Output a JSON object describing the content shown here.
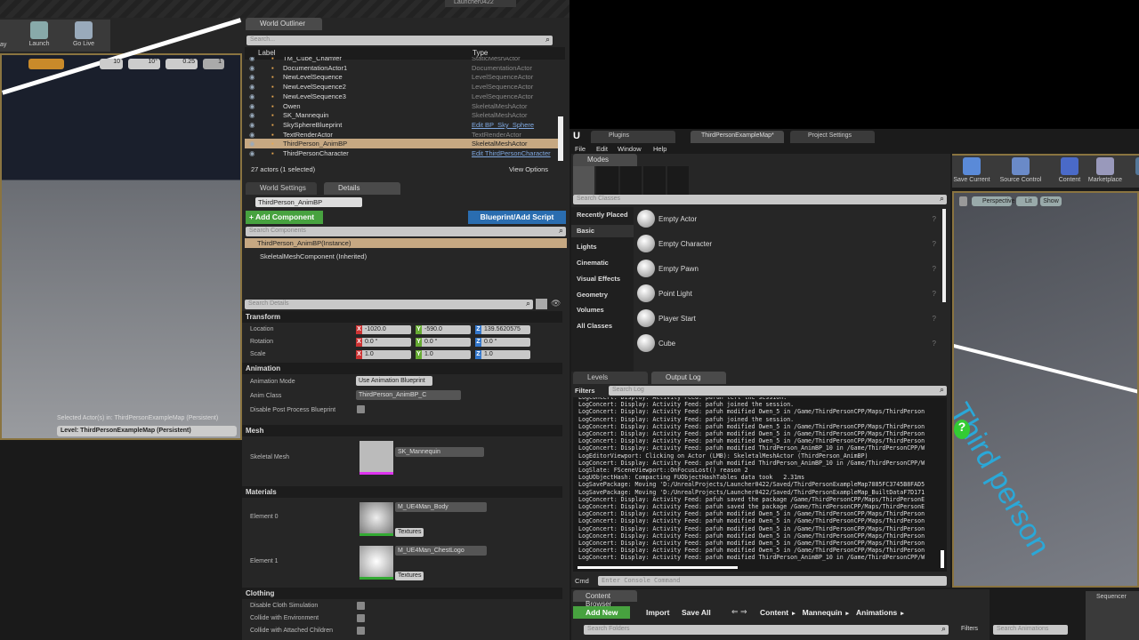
{
  "window_title": "Launcher0422",
  "left_toolbar": {
    "launch": "Launch",
    "go_live": "Go Live",
    "play_fragment": "ay",
    "grid_snap": "10",
    "rot_snap": "10°",
    "scale_snap": "0.25",
    "camera_speed": "1"
  },
  "left_viewport": {
    "selected_actors": "Selected Actor(s) in:  ThirdPersonExampleMap (Persistent)",
    "level": "Level:  ThirdPersonExampleMap (Persistent)"
  },
  "outliner": {
    "tab": "World Outliner",
    "search_placeholder": "Search...",
    "col_label": "Label",
    "col_type": "Type",
    "rows": [
      {
        "label": "TM_Cube_Chamfer",
        "type": "StaticMeshActor"
      },
      {
        "label": "DocumentationActor1",
        "type": "DocumentationActor"
      },
      {
        "label": "NewLevelSequence",
        "type": "LevelSequenceActor"
      },
      {
        "label": "NewLevelSequence2",
        "type": "LevelSequenceActor"
      },
      {
        "label": "NewLevelSequence3",
        "type": "LevelSequenceActor"
      },
      {
        "label": "Owen",
        "type": "SkeletalMeshActor"
      },
      {
        "label": "SK_Mannequin",
        "type": "SkeletalMeshActor"
      },
      {
        "label": "SkySphereBlueprint",
        "type": "Edit BP_Sky_Sphere"
      },
      {
        "label": "TextRenderActor",
        "type": "TextRenderActor"
      },
      {
        "label": "ThirdPerson_AnimBP",
        "type": "SkeletalMeshActor"
      },
      {
        "label": "ThirdPersonCharacter",
        "type": "Edit ThirdPersonCharacter"
      }
    ],
    "status": "27 actors (1 selected)",
    "view_options": "View Options"
  },
  "details": {
    "tab_world": "World Settings",
    "tab_details": "Details",
    "actor_name": "ThirdPerson_AnimBP",
    "add_component": "+ Add Component",
    "blueprint": "Blueprint/Add Script",
    "search_components": "Search Components",
    "comp_instance": "ThirdPerson_AnimBP(Instance)",
    "comp_mesh": "SkeletalMeshComponent (Inherited)",
    "search_details": "Search Details",
    "transform": {
      "title": "Transform",
      "location": "Location",
      "rotation": "Rotation",
      "scale": "Scale",
      "loc": [
        "-1020.0",
        "-590.0",
        "139.5620575"
      ],
      "rot": [
        "0.0 °",
        "0.0 °",
        "0.0 °"
      ],
      "scl": [
        "1.0",
        "1.0",
        "1.0"
      ]
    },
    "animation": {
      "title": "Animation",
      "mode_label": "Animation Mode",
      "mode_value": "Use Animation Blueprint",
      "class_label": "Anim Class",
      "class_value": "ThirdPerson_AnimBP_C",
      "disable_pp": "Disable Post Process Blueprint"
    },
    "mesh": {
      "title": "Mesh",
      "label": "Skeletal Mesh",
      "value": "SK_Mannequin"
    },
    "materials": {
      "title": "Materials",
      "e0": "Element 0",
      "e0_value": "M_UE4Man_Body",
      "e1": "Element 1",
      "e1_value": "M_UE4Man_ChestLogo",
      "textures": "Textures"
    },
    "clothing": {
      "title": "Clothing",
      "a": "Disable Cloth Simulation",
      "b": "Collide with Environment",
      "c": "Collide with Attached Children"
    }
  },
  "editor": {
    "tabs": [
      "Plugins",
      "ThirdPersonExampleMap*",
      "Project Settings"
    ],
    "menu": [
      "File",
      "Edit",
      "Window",
      "Help"
    ],
    "modes_tab": "Modes",
    "search_classes": "Search Classes",
    "categories": [
      "Recently Placed",
      "Basic",
      "Lights",
      "Cinematic",
      "Visual Effects",
      "Geometry",
      "Volumes",
      "All Classes"
    ],
    "items": [
      "Empty Actor",
      "Empty Character",
      "Empty Pawn",
      "Point Light",
      "Player Start",
      "Cube"
    ],
    "toolbar": [
      "Save Current",
      "Source Control",
      "Content",
      "Marketplace",
      "Sett"
    ],
    "viewport": {
      "perspective": "Perspective",
      "lit": "Lit",
      "show": "Show",
      "scene_text": "Third person"
    }
  },
  "log": {
    "tab_levels": "Levels",
    "tab_output": "Output Log",
    "filters": "Filters",
    "search": "Search Log",
    "cmd": "Cmd",
    "cmd_placeholder": "Enter Console Command",
    "lines": [
      "LogConcert: Display: Activity Feed: pafuh left the session.",
      "LogConcert: Display: Activity Feed: pafuh joined the session.",
      "LogConcert: Display: Activity Feed: pafuh modified Owen_5 in /Game/ThirdPersonCPP/Maps/ThirdPerson",
      "LogConcert: Display: Activity Feed: pafuh joined the session.",
      "LogConcert: Display: Activity Feed: pafuh modified Owen_5 in /Game/ThirdPersonCPP/Maps/ThirdPerson",
      "LogConcert: Display: Activity Feed: pafuh modified Owen_5 in /Game/ThirdPersonCPP/Maps/ThirdPerson",
      "LogConcert: Display: Activity Feed: pafuh modified Owen_5 in /Game/ThirdPersonCPP/Maps/ThirdPerson",
      "LogConcert: Display: Activity Feed: pafuh modified ThirdPerson_AnimBP_10 in /Game/ThirdPersonCPP/W",
      "LogEditorViewport: Clicking on Actor (LMB): SkeletalMeshActor (ThirdPerson_AnimBP)",
      "LogConcert: Display: Activity Feed: pafuh modified ThirdPerson_AnimBP_10 in /Game/ThirdPersonCPP/W",
      "LogSlate: FSceneViewport::OnFocusLost() reason 2",
      "LogUObjectHash: Compacting FUObjectHashTables data took   2.31ms",
      "LogSavePackage: Moving 'D:/UnrealProjects/Launcher0422/Saved/ThirdPersonExampleMap7885FC3745B8FAD5",
      "LogSavePackage: Moving 'D:/UnrealProjects/Launcher0422/Saved/ThirdPersonExampleMap_BuiltDataF7D171",
      "LogConcert: Display: Activity Feed: pafuh saved the package /Game/ThirdPersonCPP/Maps/ThirdPersonE",
      "LogConcert: Display: Activity Feed: pafuh saved the package /Game/ThirdPersonCPP/Maps/ThirdPersonE",
      "LogConcert: Display: Activity Feed: pafuh modified Owen_5 in /Game/ThirdPersonCPP/Maps/ThirdPerson",
      "LogConcert: Display: Activity Feed: pafuh modified Owen_5 in /Game/ThirdPersonCPP/Maps/ThirdPerson",
      "LogConcert: Display: Activity Feed: pafuh modified Owen_5 in /Game/ThirdPersonCPP/Maps/ThirdPerson",
      "LogConcert: Display: Activity Feed: pafuh modified Owen_5 in /Game/ThirdPersonCPP/Maps/ThirdPerson",
      "LogConcert: Display: Activity Feed: pafuh modified Owen_5 in /Game/ThirdPersonCPP/Maps/ThirdPerson",
      "LogConcert: Display: Activity Feed: pafuh modified Owen_5 in /Game/ThirdPersonCPP/Maps/ThirdPerson",
      "LogConcert: Display: Activity Feed: pafuh modified ThirdPerson_AnimBP_10 in /Game/ThirdPersonCPP/W"
    ]
  },
  "content_browser": {
    "tab": "Content Browser",
    "sequencer": "Sequencer",
    "add_new": "Add New",
    "import": "Import",
    "save_all": "Save All",
    "path": [
      "Content",
      "Mannequin",
      "Animations"
    ],
    "search_folders": "Search Folders",
    "filters": "Filters",
    "search_animations": "Search Animations"
  }
}
